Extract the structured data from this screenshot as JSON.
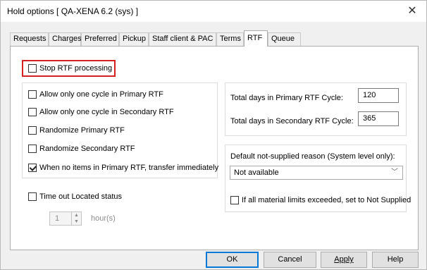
{
  "window": {
    "title": "Hold options [ QA-XENA 6.2 (sys) ]",
    "close_glyph": "✕"
  },
  "tabs": [
    {
      "label": "Requests",
      "active": false
    },
    {
      "label": "Charges",
      "active": false
    },
    {
      "label": "Preferred",
      "active": false
    },
    {
      "label": "Pickup",
      "active": false
    },
    {
      "label": "Staff client & PAC",
      "active": false
    },
    {
      "label": "Terms",
      "active": false
    },
    {
      "label": "RTF",
      "active": true
    },
    {
      "label": "Queue",
      "active": false
    }
  ],
  "rtf": {
    "stop_processing": {
      "label": "Stop RTF processing",
      "checked": false
    },
    "left_options": [
      {
        "label": "Allow only one cycle in Primary RTF",
        "checked": false
      },
      {
        "label": "Allow only one cycle in Secondary RTF",
        "checked": false
      },
      {
        "label": "Randomize Primary RTF",
        "checked": false
      },
      {
        "label": "Randomize Secondary RTF",
        "checked": false
      },
      {
        "label": "When no items in Primary RTF, transfer immediately",
        "checked": true
      }
    ],
    "timeout": {
      "label": "Time out Located status",
      "checked": false,
      "value": "1",
      "unit": "hour(s)"
    },
    "primary_days": {
      "label": "Total days in Primary RTF Cycle:",
      "value": "120"
    },
    "secondary_days": {
      "label": "Total days in Secondary RTF Cycle:",
      "value": "365"
    },
    "not_supplied": {
      "label": "Default not-supplied reason (System level only):",
      "selected": "Not available",
      "limits_label": "If all material limits exceeded, set to Not Supplied",
      "limits_checked": false
    }
  },
  "buttons": {
    "ok": "OK",
    "cancel": "Cancel",
    "apply": "Apply",
    "help": "Help"
  },
  "colors": {
    "highlight": "#d42020",
    "default_button": "#0078d7"
  }
}
